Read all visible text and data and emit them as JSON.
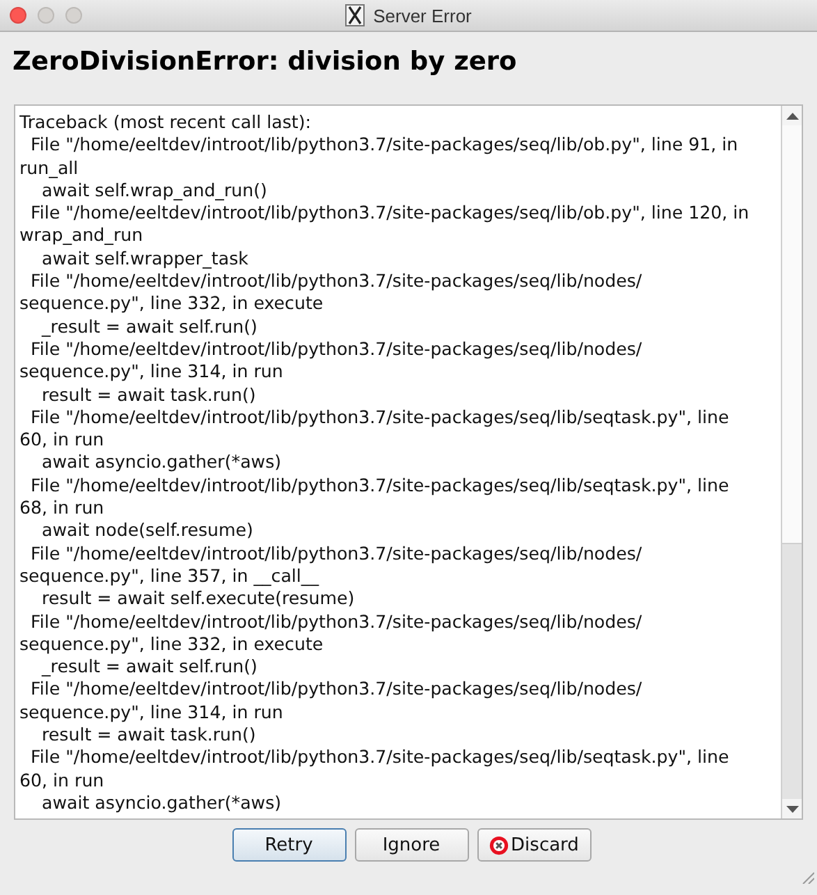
{
  "window": {
    "title": "Server Error"
  },
  "heading": "ZeroDivisionError: division by zero",
  "traceback": [
    {
      "kind": "header",
      "text": "Traceback (most recent call last):"
    },
    {
      "kind": "file",
      "text": "File \"/home/eeltdev/introot/lib/python3.7/site-packages/seq/lib/ob.py\", line 91, in"
    },
    {
      "kind": "wrap",
      "text": "run_all"
    },
    {
      "kind": "code",
      "text": "await self.wrap_and_run()"
    },
    {
      "kind": "file",
      "text": "File \"/home/eeltdev/introot/lib/python3.7/site-packages/seq/lib/ob.py\", line 120, in"
    },
    {
      "kind": "wrap",
      "text": "wrap_and_run"
    },
    {
      "kind": "code",
      "text": "await self.wrapper_task"
    },
    {
      "kind": "file",
      "text": "File \"/home/eeltdev/introot/lib/python3.7/site-packages/seq/lib/nodes/"
    },
    {
      "kind": "wrap",
      "text": "sequence.py\", line 332, in execute"
    },
    {
      "kind": "code",
      "text": "_result = await self.run()"
    },
    {
      "kind": "file",
      "text": "File \"/home/eeltdev/introot/lib/python3.7/site-packages/seq/lib/nodes/"
    },
    {
      "kind": "wrap",
      "text": "sequence.py\", line 314, in run"
    },
    {
      "kind": "code",
      "text": "result = await task.run()"
    },
    {
      "kind": "file",
      "text": "File \"/home/eeltdev/introot/lib/python3.7/site-packages/seq/lib/seqtask.py\", line"
    },
    {
      "kind": "wrap",
      "text": "60, in run"
    },
    {
      "kind": "code",
      "text": "await asyncio.gather(*aws)"
    },
    {
      "kind": "file",
      "text": "File \"/home/eeltdev/introot/lib/python3.7/site-packages/seq/lib/seqtask.py\", line"
    },
    {
      "kind": "wrap",
      "text": "68, in run"
    },
    {
      "kind": "code",
      "text": "await node(self.resume)"
    },
    {
      "kind": "file",
      "text": "File \"/home/eeltdev/introot/lib/python3.7/site-packages/seq/lib/nodes/"
    },
    {
      "kind": "wrap",
      "text": "sequence.py\", line 357, in __call__"
    },
    {
      "kind": "code",
      "text": "result = await self.execute(resume)"
    },
    {
      "kind": "file",
      "text": "File \"/home/eeltdev/introot/lib/python3.7/site-packages/seq/lib/nodes/"
    },
    {
      "kind": "wrap",
      "text": "sequence.py\", line 332, in execute"
    },
    {
      "kind": "code",
      "text": "_result = await self.run()"
    },
    {
      "kind": "file",
      "text": "File \"/home/eeltdev/introot/lib/python3.7/site-packages/seq/lib/nodes/"
    },
    {
      "kind": "wrap",
      "text": "sequence.py\", line 314, in run"
    },
    {
      "kind": "code",
      "text": "result = await task.run()"
    },
    {
      "kind": "file",
      "text": "File \"/home/eeltdev/introot/lib/python3.7/site-packages/seq/lib/seqtask.py\", line"
    },
    {
      "kind": "wrap",
      "text": "60, in run"
    },
    {
      "kind": "code",
      "text": "await asyncio.gather(*aws)"
    }
  ],
  "buttons": [
    {
      "label": "Retry",
      "default": true,
      "kind": "plain"
    },
    {
      "label": "Ignore",
      "default": false,
      "kind": "plain"
    },
    {
      "label": "Discard",
      "default": false,
      "kind": "discard"
    }
  ]
}
